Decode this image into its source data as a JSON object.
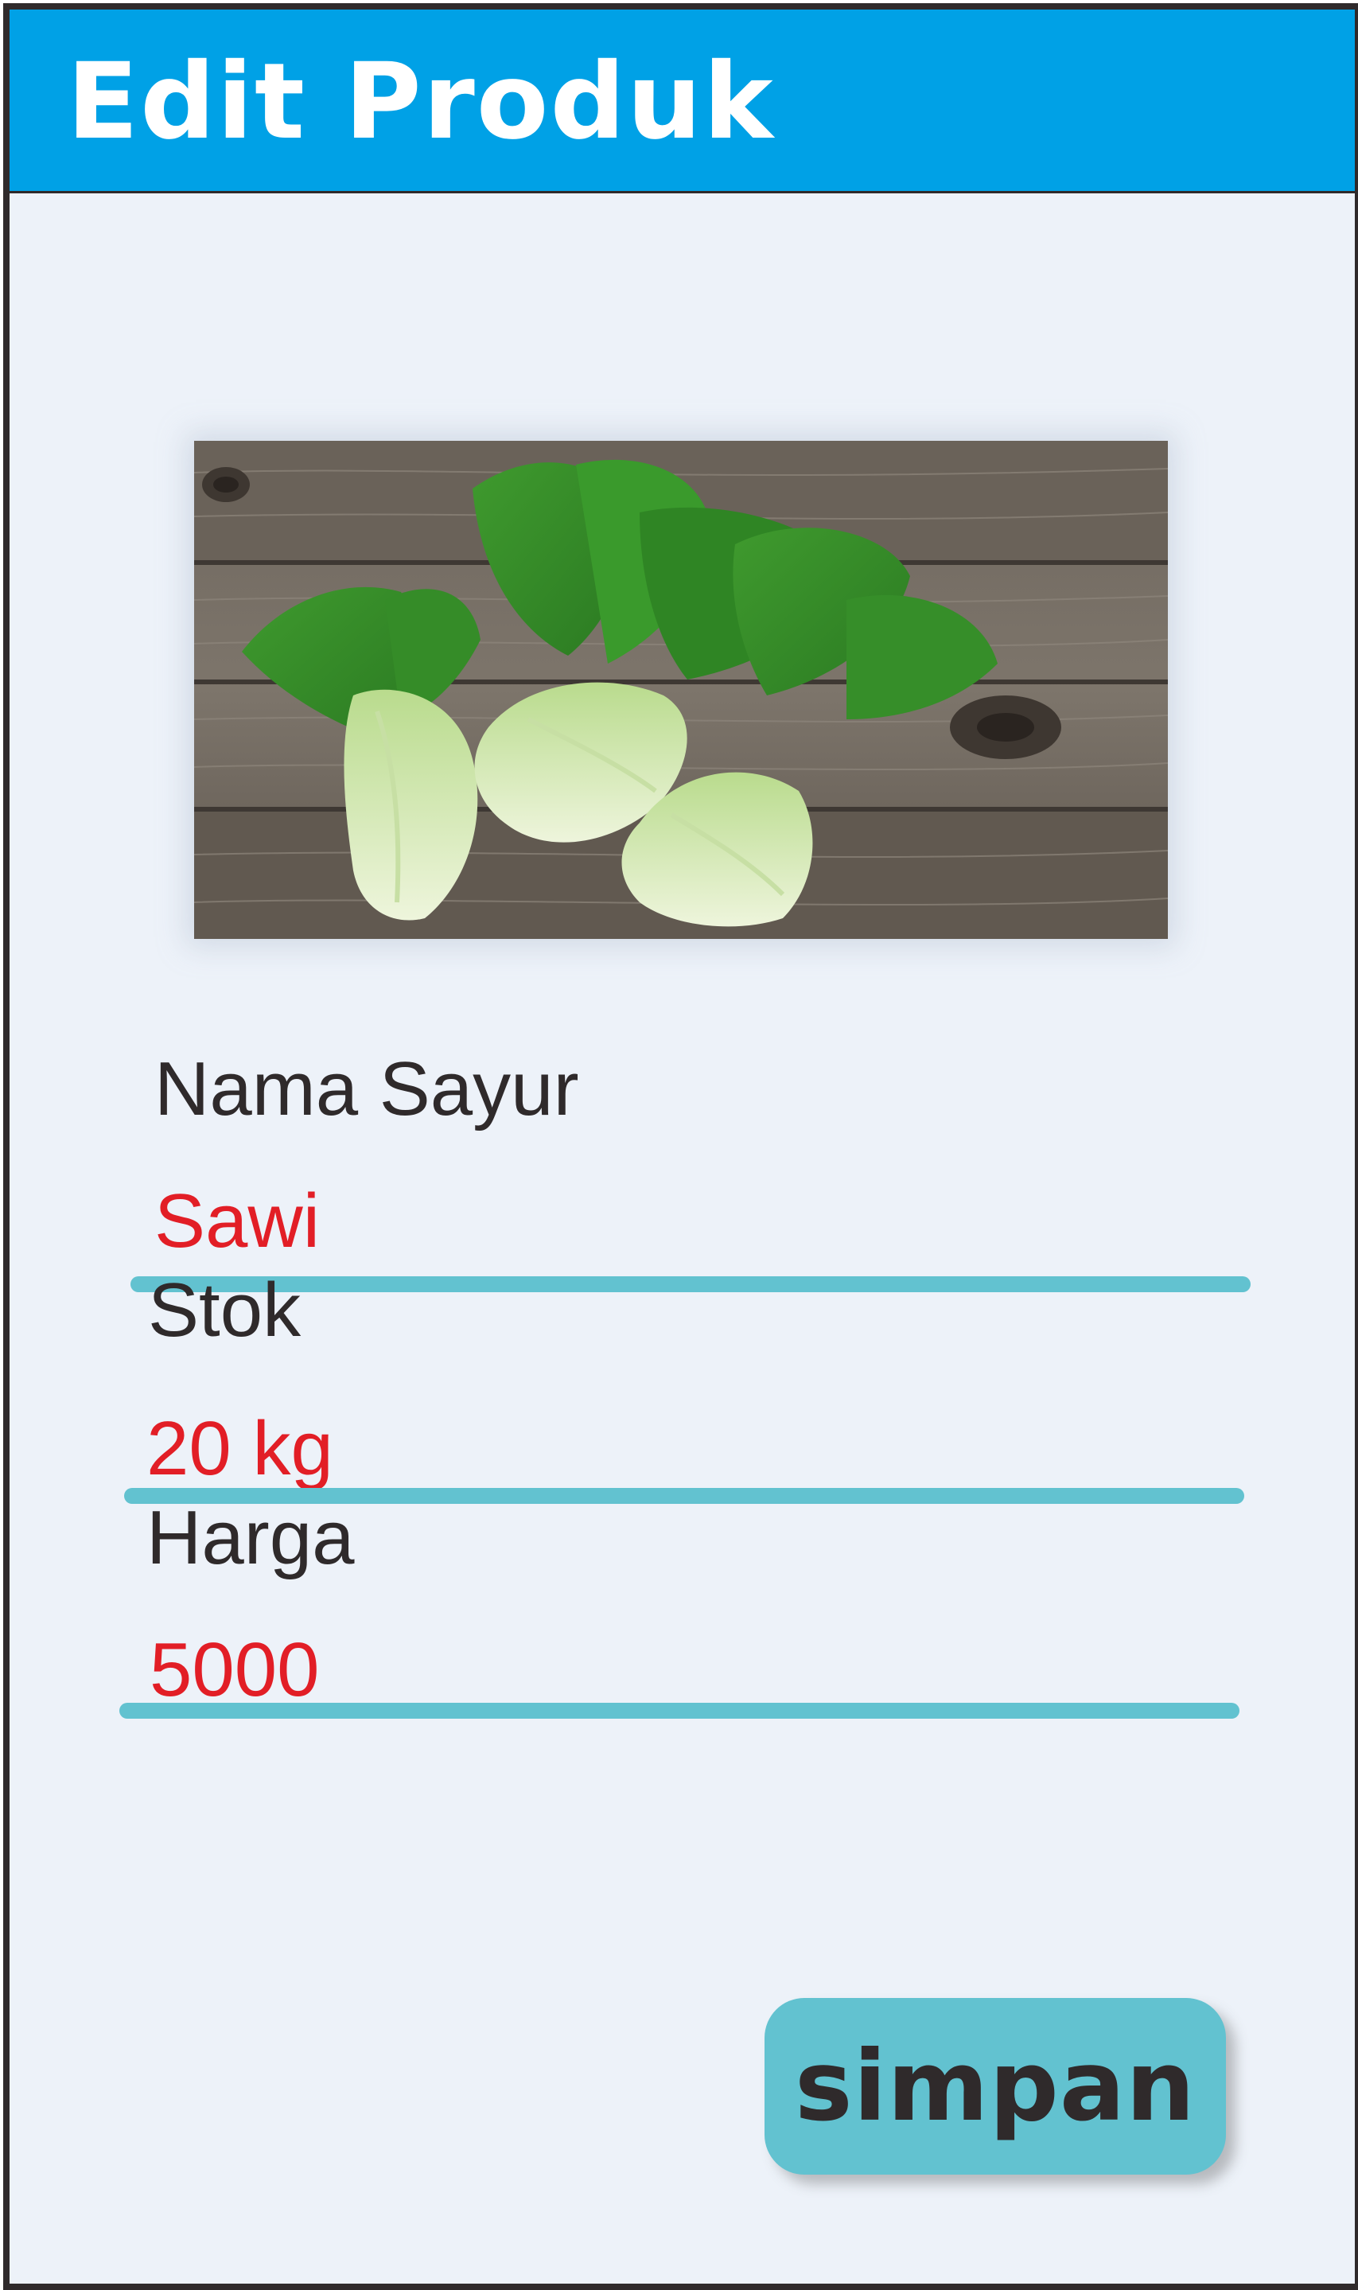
{
  "header": {
    "title": "Edit Produk"
  },
  "product_image": {
    "subject": "pak choy on a wooden table"
  },
  "form": {
    "fields": [
      {
        "label": "Nama Sayur",
        "value": "Sawi"
      },
      {
        "label": "Stok",
        "value": "20 kg"
      },
      {
        "label": "Harga",
        "value": "5000"
      }
    ]
  },
  "actions": {
    "save_label": "simpan"
  },
  "colors": {
    "header": "#00a1e6",
    "background": "#edf2f9",
    "accent": "#62c2d0",
    "value_text": "#e21e26",
    "label_text": "#2f2a2b"
  }
}
